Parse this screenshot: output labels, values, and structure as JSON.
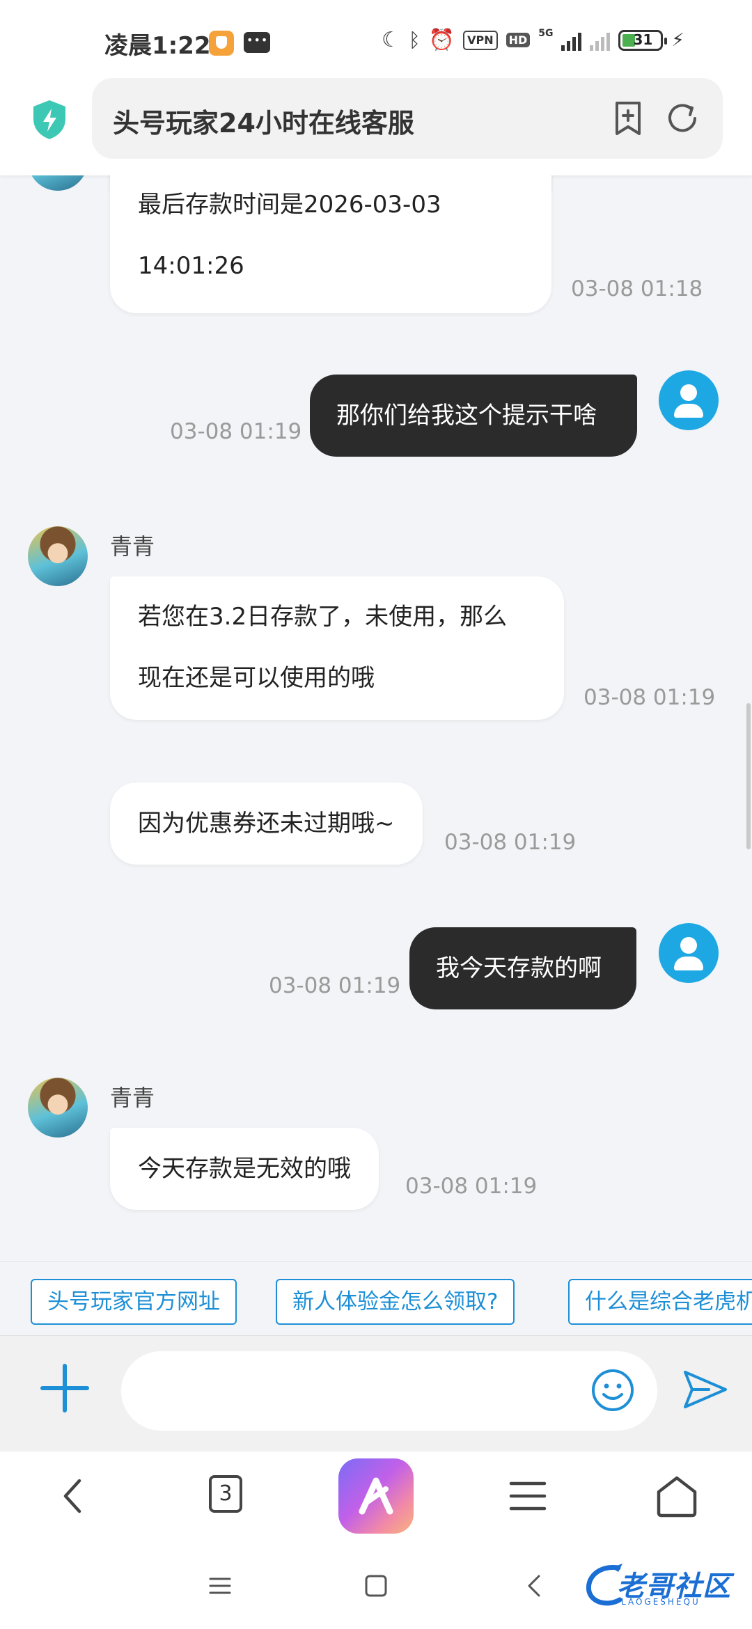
{
  "status_bar": {
    "time": "凌晨1:22",
    "vpn_label": "VPN",
    "hd_label": "HD",
    "network_label": "5G",
    "battery_level": "31"
  },
  "address_bar": {
    "title": "头号玩家24小时在线客服"
  },
  "chat": {
    "msg1_text_line1": "最后存款时间是2026-03-03",
    "msg1_text_line2": "14:01:26",
    "msg1_time": "03-08 01:18",
    "msg2_text": "那你们给我这个提示干啥",
    "msg2_time": "03-08 01:19",
    "msg3_sender": "青青",
    "msg3_text_line1": "若您在3.2日存款了，未使用，那么",
    "msg3_text_line2": "现在还是可以使用的哦",
    "msg3_time": "03-08 01:19",
    "msg4_text": "因为优惠券还未过期哦~",
    "msg4_time": "03-08 01:19",
    "msg5_text": "我今天存款的啊",
    "msg5_time": "03-08 01:19",
    "msg6_sender": "青青",
    "msg6_text": "今天存款是无效的哦",
    "msg6_time": "03-08 01:19"
  },
  "quick_replies": [
    "头号玩家官方网址",
    "新人体验金怎么领取?",
    "什么是综合老虎机"
  ],
  "input_bar": {
    "placeholder": ""
  },
  "browser_toolbar": {
    "tab_count": "3"
  },
  "watermark": {
    "text": "老哥社区",
    "sub": "LAOGESHEQU"
  },
  "colors": {
    "accent": "#1d8fd6",
    "user_bubble": "#2b2b2b",
    "user_avatar": "#1ea8e3",
    "shield": "#3cc8b4"
  }
}
